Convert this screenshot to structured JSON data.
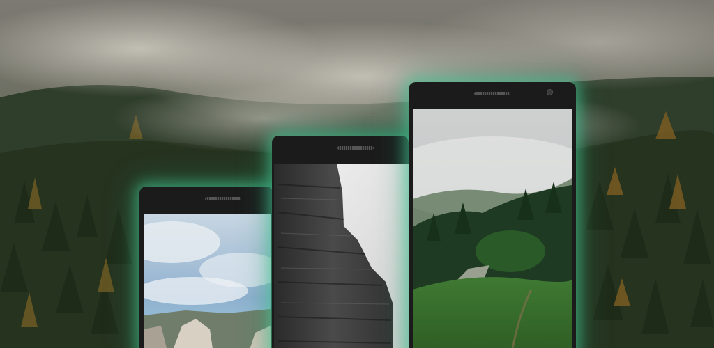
{
  "scene": {
    "background_image": "misty-forest-mountain",
    "accent_glow_color": "#46c896"
  },
  "phones": [
    {
      "name": "phone-left",
      "wallpaper": "sky-clouds-cliffs"
    },
    {
      "name": "phone-middle",
      "wallpaper": "black-white-rock-cliff"
    },
    {
      "name": "phone-right",
      "wallpaper": "misty-green-hill"
    }
  ]
}
